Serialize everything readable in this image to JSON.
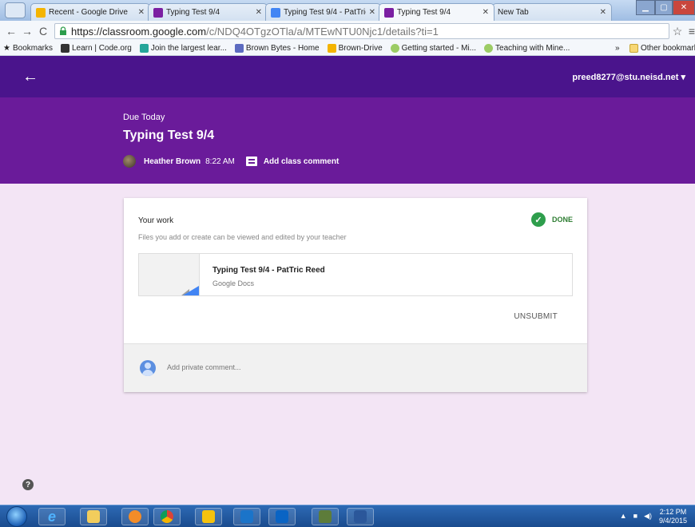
{
  "browser": {
    "tabs": [
      {
        "label": "Recent - Google Drive",
        "color": "#f4b400"
      },
      {
        "label": "Typing Test 9/4",
        "color": "#7b1fa2"
      },
      {
        "label": "Typing Test 9/4 - PatTric",
        "color": "#4285f4"
      },
      {
        "label": "Typing Test 9/4",
        "color": "#7b1fa2"
      },
      {
        "label": "New Tab",
        "color": ""
      }
    ],
    "url_host": "https://classroom.google.com",
    "url_path": "/c/NDQ4OTgzOTla/a/MTEwNTU0Njc1/details?ti=1",
    "bookmarks": [
      {
        "label": "Bookmarks",
        "color": "#555555"
      },
      {
        "label": "Learn | Code.org",
        "color": "#333333"
      },
      {
        "label": "Join the largest lear...",
        "color": "#26a69a"
      },
      {
        "label": "Brown Bytes - Home",
        "color": "#5c6bc0"
      },
      {
        "label": "Brown-Drive",
        "color": "#f4b400"
      },
      {
        "label": "Getting started - Mi...",
        "color": "#9ccc65"
      },
      {
        "label": "Teaching with Mine...",
        "color": "#9ccc65"
      }
    ],
    "bookmarks_overflow": "»",
    "other_bookmarks": "Other bookmarks"
  },
  "header": {
    "account": "preed8277@stu.neisd.net",
    "due": "Due Today",
    "title": "Typing Test 9/4",
    "teacher": "Heather Brown",
    "time": "8:22 AM",
    "add_comment": "Add class comment"
  },
  "card": {
    "your_work": "Your work",
    "subtitle": "Files you add or create can be viewed and edited by your teacher",
    "status": "DONE",
    "attachment_name": "Typing Test 9/4 - PatTric Reed",
    "attachment_type": "Google Docs",
    "unsubmit": "UNSUBMIT",
    "private_comment": "Add private comment..."
  },
  "taskbar": {
    "time": "2:12 PM",
    "date": "9/4/2015"
  },
  "colors": {
    "appbar": "#4a148c",
    "banner": "#6a1b9a",
    "background": "#f3e5f5",
    "done": "#2e7d32"
  }
}
